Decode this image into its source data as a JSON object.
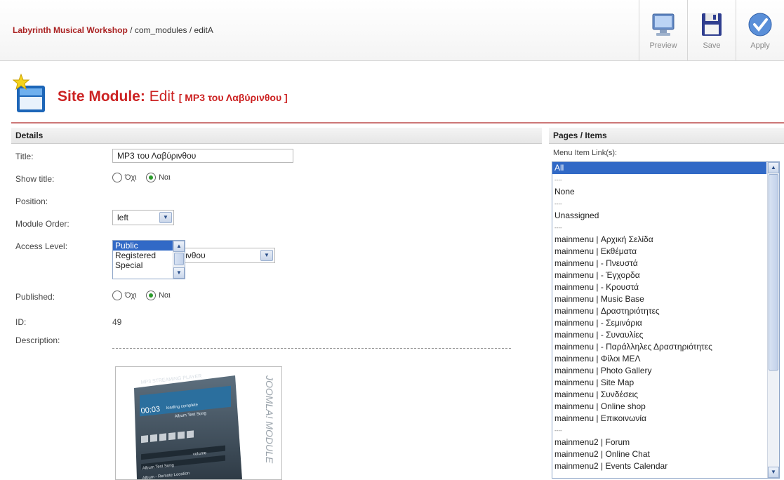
{
  "breadcrumb": {
    "site": "Labyrinth Musical Workshop",
    "path": " / com_modules / editA"
  },
  "toolbar": {
    "preview": "Preview",
    "save": "Save",
    "apply": "Apply"
  },
  "heading": {
    "title": "Site Module:",
    "action": "Edit",
    "name": "[ MP3 του Λαβύρινθου ]"
  },
  "details": {
    "section": "Details",
    "title_label": "Title:",
    "title_value": "MP3 του Λαβύρινθου",
    "show_title_label": "Show title:",
    "radio_no": "Όχι",
    "radio_yes": "Ναι",
    "position_label": "Position:",
    "position_value": "left",
    "order_label": "Module Order:",
    "order_value": "8::MP3 του Λαβύρινθου",
    "access_label": "Access Level:",
    "access_options": [
      "Public",
      "Registered",
      "Special"
    ],
    "published_label": "Published:",
    "id_label": "ID:",
    "id_value": "49",
    "description_label": "Description:"
  },
  "module_image": {
    "brand": "MP3 STREAMING PLAYER",
    "time": "00:03",
    "status": "loading complete",
    "track": "Album Test Song",
    "volume": "volume",
    "list_item1": "Album Test Song",
    "list_item2": "Album - Remote Location",
    "side_text": "JOOMLA! MODULE"
  },
  "pages": {
    "section": "Pages / Items",
    "menu_label": "Menu Item Link(s):",
    "items": [
      "All",
      "----",
      "None",
      "----",
      "Unassigned",
      "----",
      "mainmenu | Αρχική Σελίδα",
      "mainmenu | Εκθέματα",
      "mainmenu |   - Πνευστά",
      "mainmenu |   - Έγχορδα",
      "mainmenu |   - Κρουστά",
      "mainmenu | Music Base",
      "mainmenu | Δραστηριότητες",
      "mainmenu |   - Σεμινάρια",
      "mainmenu |   - Συναυλίες",
      "mainmenu |   - Παράλληλες Δραστηριότητες",
      "mainmenu | Φίλοι ΜΕΛ",
      "mainmenu | Photo Gallery",
      "mainmenu | Site Map",
      "mainmenu | Συνδέσεις",
      "mainmenu | Online shop",
      "mainmenu | Επικοινωνία",
      "----",
      "mainmenu2 | Forum",
      "mainmenu2 | Online Chat",
      "mainmenu2 | Events Calendar"
    ]
  },
  "colors": {
    "brand_red": "#cc2222",
    "selection_blue": "#3169c6"
  }
}
